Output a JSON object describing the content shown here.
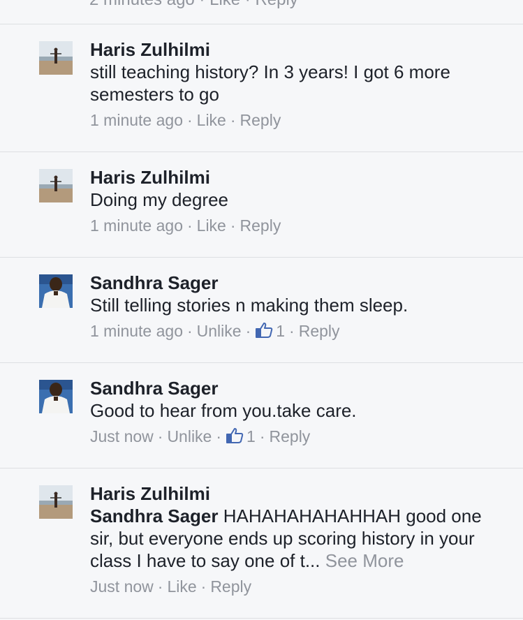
{
  "top_fragment": "2 minutes ago · Like · Reply",
  "comments": [
    {
      "author": "Haris Zulhilmi",
      "text": "still teaching history? In 3 years! I got 6 more semesters to go",
      "time": "1 minute ago",
      "action": "Like",
      "likes": "",
      "reply": "Reply"
    },
    {
      "author": "Haris Zulhilmi",
      "text": "Doing my degree",
      "time": "1 minute ago",
      "action": "Like",
      "likes": "",
      "reply": "Reply"
    },
    {
      "author": "Sandhra Sager",
      "text": "Still telling stories n making them sleep.",
      "time": "1 minute ago",
      "action": "Unlike",
      "likes": "1",
      "reply": "Reply"
    },
    {
      "author": "Sandhra Sager",
      "text": "Good to hear from you.take care.",
      "time": "Just now",
      "action": "Unlike",
      "likes": "1",
      "reply": "Reply"
    },
    {
      "author": "Haris Zulhilmi",
      "mention": "Sandhra Sager",
      "text": "HAHAHAHAHAHHAH good one sir, but everyone ends up scoring history in your class I have to say one of t...",
      "see_more": "See More",
      "time": "Just now",
      "action": "Like",
      "likes": "",
      "reply": "Reply"
    }
  ],
  "colors": {
    "background": "#f6f7f9",
    "text": "#1d2129",
    "meta": "#90949c",
    "like_blue": "#4267b2"
  },
  "icons": {
    "like": "thumbs-up-icon",
    "avatar_haris": "beach-photo-avatar",
    "avatar_sandhra": "portrait-photo-avatar"
  }
}
